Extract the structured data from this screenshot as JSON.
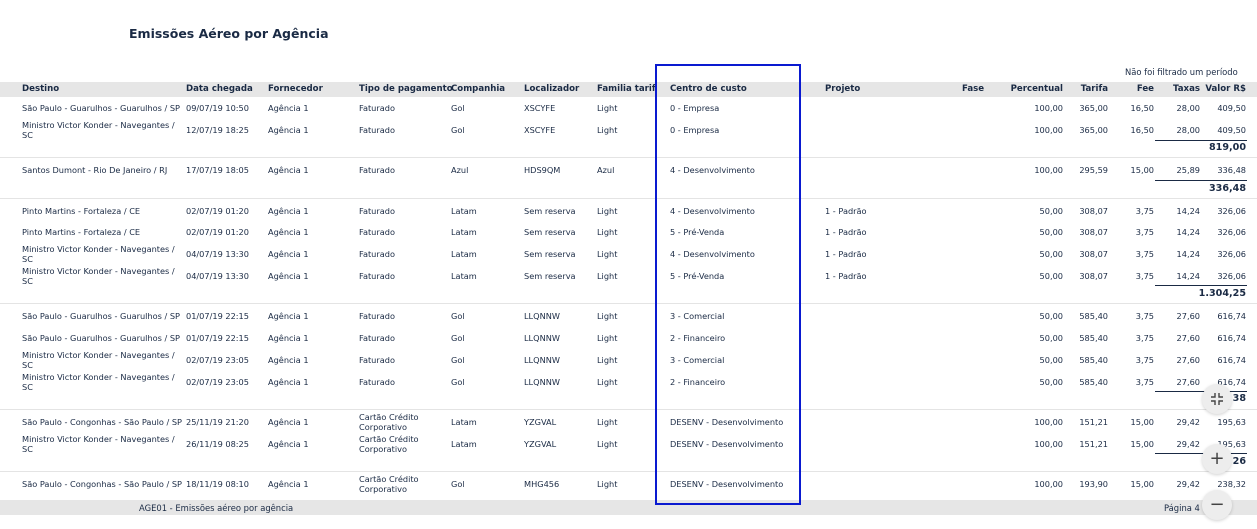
{
  "report": {
    "title": "Emissões Aéreo por Agência",
    "filter_note": "Não foi filtrado um período"
  },
  "columns": {
    "destino": "Destino",
    "data_chegada": "Data chegada",
    "fornecedor": "Fornecedor",
    "tipo_pagamento": "Tipo de pagamento",
    "companhia": "Companhia",
    "localizador": "Localizador",
    "familia_tarifa": "Familia tarifa",
    "centro_custo": "Centro de custo",
    "projeto": "Projeto",
    "fase": "Fase",
    "percentual": "Percentual",
    "tarifa": "Tarifa",
    "fee": "Fee",
    "taxas": "Taxas",
    "valor": "Valor R$"
  },
  "rows": [
    {
      "destino": "São Paulo - Guarulhos - Guarulhos / SP",
      "data": "09/07/19 10:50",
      "fornecedor": "Agência 1",
      "pagamento": "Faturado",
      "companhia": "Gol",
      "localizador": "XSCYFE",
      "familia": "Light",
      "centro": "0 - Empresa",
      "projeto": "",
      "percentual": "100,00",
      "tarifa": "365,00",
      "fee": "16,50",
      "taxas": "28,00",
      "valor": "409,50"
    },
    {
      "destino": "Ministro Victor Konder - Navegantes / SC",
      "data": "12/07/19 18:25",
      "fornecedor": "Agência 1",
      "pagamento": "Faturado",
      "companhia": "Gol",
      "localizador": "XSCYFE",
      "familia": "Light",
      "centro": "0 - Empresa",
      "projeto": "",
      "percentual": "100,00",
      "tarifa": "365,00",
      "fee": "16,50",
      "taxas": "28,00",
      "valor": "409,50"
    },
    {
      "destino": "Santos Dumont - Rio De Janeiro / RJ",
      "data": "17/07/19 18:05",
      "fornecedor": "Agência 1",
      "pagamento": "Faturado",
      "companhia": "Azul",
      "localizador": "HDS9QM",
      "familia": "Azul",
      "centro": "4 - Desenvolvimento",
      "projeto": "",
      "percentual": "100,00",
      "tarifa": "295,59",
      "fee": "15,00",
      "taxas": "25,89",
      "valor": "336,48"
    },
    {
      "destino": "Pinto Martins - Fortaleza / CE",
      "data": "02/07/19 01:20",
      "fornecedor": "Agência 1",
      "pagamento": "Faturado",
      "companhia": "Latam",
      "localizador": "Sem reserva",
      "familia": "Light",
      "centro": "4 - Desenvolvimento",
      "projeto": "1 - Padrão",
      "percentual": "50,00",
      "tarifa": "308,07",
      "fee": "3,75",
      "taxas": "14,24",
      "valor": "326,06"
    },
    {
      "destino": "Pinto Martins - Fortaleza / CE",
      "data": "02/07/19 01:20",
      "fornecedor": "Agência 1",
      "pagamento": "Faturado",
      "companhia": "Latam",
      "localizador": "Sem reserva",
      "familia": "Light",
      "centro": "5 - Pré-Venda",
      "projeto": "1 - Padrão",
      "percentual": "50,00",
      "tarifa": "308,07",
      "fee": "3,75",
      "taxas": "14,24",
      "valor": "326,06"
    },
    {
      "destino": "Ministro Victor Konder - Navegantes / SC",
      "data": "04/07/19 13:30",
      "fornecedor": "Agência 1",
      "pagamento": "Faturado",
      "companhia": "Latam",
      "localizador": "Sem reserva",
      "familia": "Light",
      "centro": "4 - Desenvolvimento",
      "projeto": "1 - Padrão",
      "percentual": "50,00",
      "tarifa": "308,07",
      "fee": "3,75",
      "taxas": "14,24",
      "valor": "326,06"
    },
    {
      "destino": "Ministro Victor Konder - Navegantes / SC",
      "data": "04/07/19 13:30",
      "fornecedor": "Agência 1",
      "pagamento": "Faturado",
      "companhia": "Latam",
      "localizador": "Sem reserva",
      "familia": "Light",
      "centro": "5 - Pré-Venda",
      "projeto": "1 - Padrão",
      "percentual": "50,00",
      "tarifa": "308,07",
      "fee": "3,75",
      "taxas": "14,24",
      "valor": "326,06"
    },
    {
      "destino": "São Paulo - Guarulhos - Guarulhos / SP",
      "data": "01/07/19 22:15",
      "fornecedor": "Agência 1",
      "pagamento": "Faturado",
      "companhia": "Gol",
      "localizador": "LLQNNW",
      "familia": "Light",
      "centro": "3 - Comercial",
      "projeto": "",
      "percentual": "50,00",
      "tarifa": "585,40",
      "fee": "3,75",
      "taxas": "27,60",
      "valor": "616,74"
    },
    {
      "destino": "São Paulo - Guarulhos - Guarulhos / SP",
      "data": "01/07/19 22:15",
      "fornecedor": "Agência 1",
      "pagamento": "Faturado",
      "companhia": "Gol",
      "localizador": "LLQNNW",
      "familia": "Light",
      "centro": "2 - Financeiro",
      "projeto": "",
      "percentual": "50,00",
      "tarifa": "585,40",
      "fee": "3,75",
      "taxas": "27,60",
      "valor": "616,74"
    },
    {
      "destino": "Ministro Victor Konder - Navegantes / SC",
      "data": "02/07/19 23:05",
      "fornecedor": "Agência 1",
      "pagamento": "Faturado",
      "companhia": "Gol",
      "localizador": "LLQNNW",
      "familia": "Light",
      "centro": "3 - Comercial",
      "projeto": "",
      "percentual": "50,00",
      "tarifa": "585,40",
      "fee": "3,75",
      "taxas": "27,60",
      "valor": "616,74"
    },
    {
      "destino": "Ministro Victor Konder - Navegantes / SC",
      "data": "02/07/19 23:05",
      "fornecedor": "Agência 1",
      "pagamento": "Faturado",
      "companhia": "Gol",
      "localizador": "LLQNNW",
      "familia": "Light",
      "centro": "2 - Financeiro",
      "projeto": "",
      "percentual": "50,00",
      "tarifa": "585,40",
      "fee": "3,75",
      "taxas": "27,60",
      "valor": "616,74"
    },
    {
      "destino": "São Paulo - Congonhas - São Paulo / SP",
      "data": "25/11/19 21:20",
      "fornecedor": "Agência 1",
      "pagamento": "Cartão Crédito Corporativo",
      "companhia": "Latam",
      "localizador": "YZGVAL",
      "familia": "Light",
      "centro": "DESENV - Desenvolvimento",
      "projeto": "",
      "percentual": "100,00",
      "tarifa": "151,21",
      "fee": "15,00",
      "taxas": "29,42",
      "valor": "195,63"
    },
    {
      "destino": "Ministro Victor Konder - Navegantes / SC",
      "data": "26/11/19 08:25",
      "fornecedor": "Agência 1",
      "pagamento": "Cartão Crédito Corporativo",
      "companhia": "Latam",
      "localizador": "YZGVAL",
      "familia": "Light",
      "centro": "DESENV - Desenvolvimento",
      "projeto": "",
      "percentual": "100,00",
      "tarifa": "151,21",
      "fee": "15,00",
      "taxas": "29,42",
      "valor": "195,63"
    },
    {
      "destino": "São Paulo - Congonhas - São Paulo / SP",
      "data": "18/11/19 08:10",
      "fornecedor": "Agência 1",
      "pagamento": "Cartão Crédito Corporativo",
      "companhia": "Gol",
      "localizador": "MHG456",
      "familia": "Light",
      "centro": "DESENV - Desenvolvimento",
      "projeto": "",
      "percentual": "100,00",
      "tarifa": "193,90",
      "fee": "15,00",
      "taxas": "29,42",
      "valor": "238,32"
    }
  ],
  "subtotals": [
    "819,00",
    "336,48",
    "1.304,25",
    "38",
    "26"
  ],
  "footer": {
    "code": "AGE01 - Emissões aéreo por agência",
    "page": "Página 4"
  },
  "controls": {
    "fit_icon": "collapse-arrows-icon",
    "zoom_in": "+",
    "zoom_out": "−"
  },
  "colors": {
    "text": "#1a2a44",
    "band": "#e6e6e6",
    "highlight": "#0a1ad0"
  }
}
